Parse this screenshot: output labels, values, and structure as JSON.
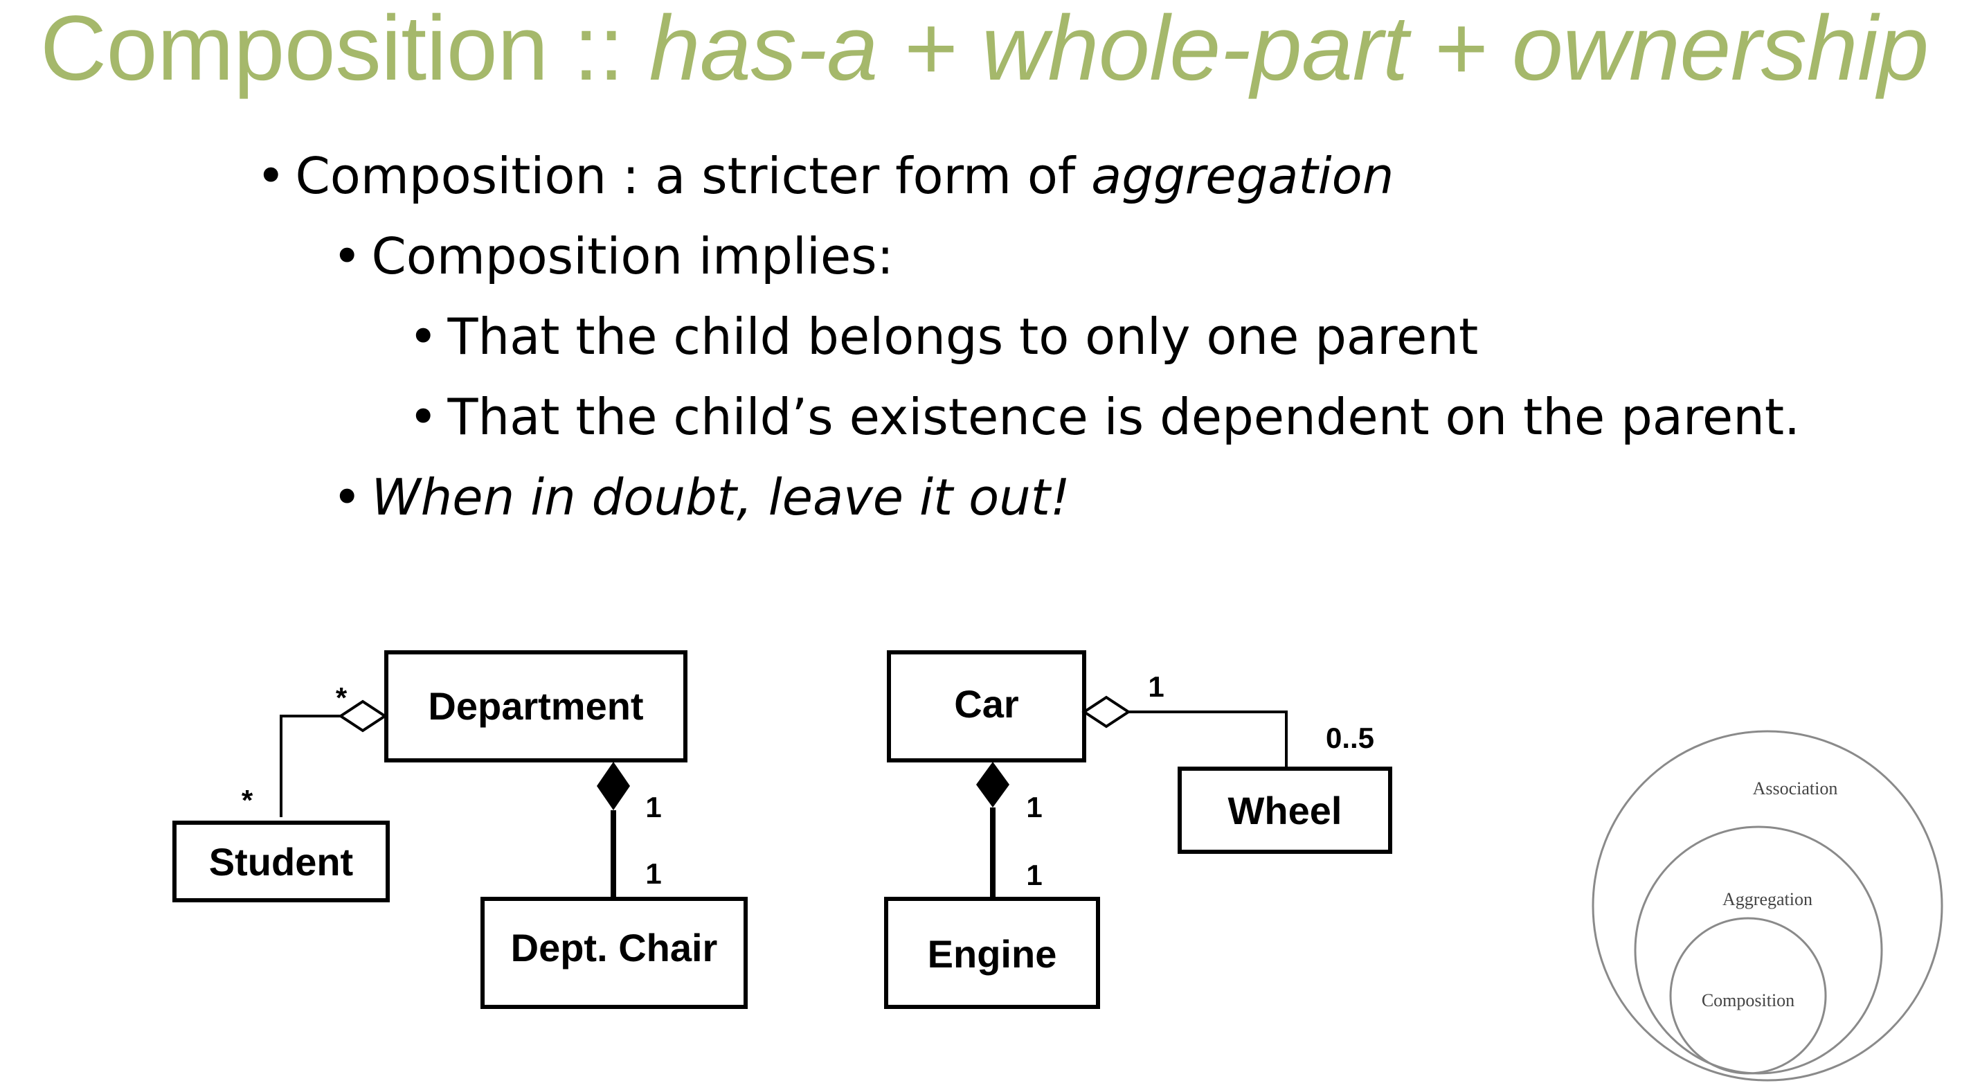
{
  "title": {
    "main": "Composition ::",
    "emphasis": "has-a + whole-part + ownership"
  },
  "bullets": [
    {
      "pre": "Composition :  a stricter form of ",
      "em": "aggregation"
    },
    {
      "text": "Composition implies:"
    },
    {
      "text": "That the child belongs to only one parent"
    },
    {
      "text": "That the child’s existence is dependent on the parent."
    },
    {
      "em": "When in doubt, leave it out!"
    }
  ],
  "diagram_left": {
    "department": "Department",
    "student": "Student",
    "chair": "Dept. Chair",
    "mult_agg_whole": "*",
    "mult_agg_part": "*",
    "mult_comp_whole": "1",
    "mult_comp_part": "1"
  },
  "diagram_right": {
    "car": "Car",
    "wheel": "Wheel",
    "engine": "Engine",
    "mult_agg_whole": "1",
    "mult_agg_part": "0..5",
    "mult_comp_whole": "1",
    "mult_comp_part": "1"
  },
  "venn": {
    "outer": "Association",
    "middle": "Aggregation",
    "inner": "Composition"
  }
}
